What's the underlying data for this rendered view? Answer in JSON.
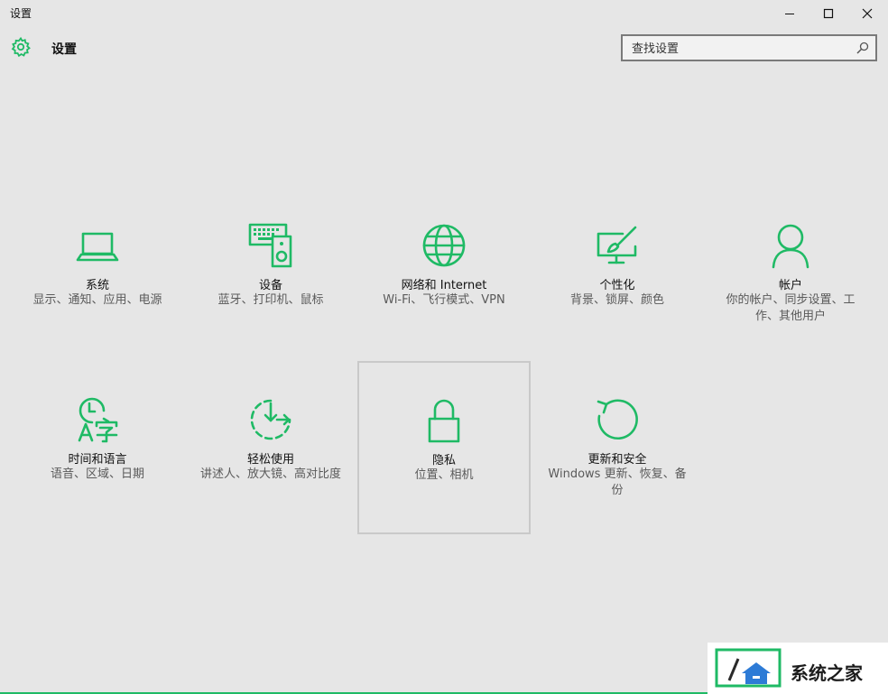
{
  "window": {
    "title": "设置",
    "controls": {
      "minimize": "minimize-icon",
      "maximize": "maximize-icon",
      "close": "close-icon"
    }
  },
  "header": {
    "icon": "gear-icon",
    "title": "设置"
  },
  "search": {
    "placeholder": "查找设置",
    "value": "",
    "icon": "search-icon"
  },
  "tiles": [
    {
      "label": "系统",
      "desc": "显示、通知、应用、电源",
      "icon": "laptop-icon"
    },
    {
      "label": "设备",
      "desc": "蓝牙、打印机、鼠标",
      "icon": "keyboard-speaker-icon"
    },
    {
      "label": "网络和 Internet",
      "desc": "Wi-Fi、飞行模式、VPN",
      "icon": "globe-icon"
    },
    {
      "label": "个性化",
      "desc": "背景、锁屏、颜色",
      "icon": "paint-brush-monitor-icon"
    },
    {
      "label": "帐户",
      "desc": "你的帐户、同步设置、工作、其他用户",
      "icon": "person-icon"
    },
    {
      "label": "时间和语言",
      "desc": "语音、区域、日期",
      "icon": "clock-language-icon"
    },
    {
      "label": "轻松使用",
      "desc": "讲述人、放大镜、高对比度",
      "icon": "ease-of-access-icon"
    },
    {
      "label": "隐私",
      "desc": "位置、相机",
      "icon": "lock-icon"
    },
    {
      "label": "更新和安全",
      "desc": "Windows 更新、恢复、备份",
      "icon": "refresh-icon"
    }
  ],
  "selected_tile": "隐私",
  "watermark": {
    "text": "系统之家",
    "logo": "watermark-logo"
  },
  "colors": {
    "accent": "#1fba65",
    "background": "#e6e6e6"
  }
}
